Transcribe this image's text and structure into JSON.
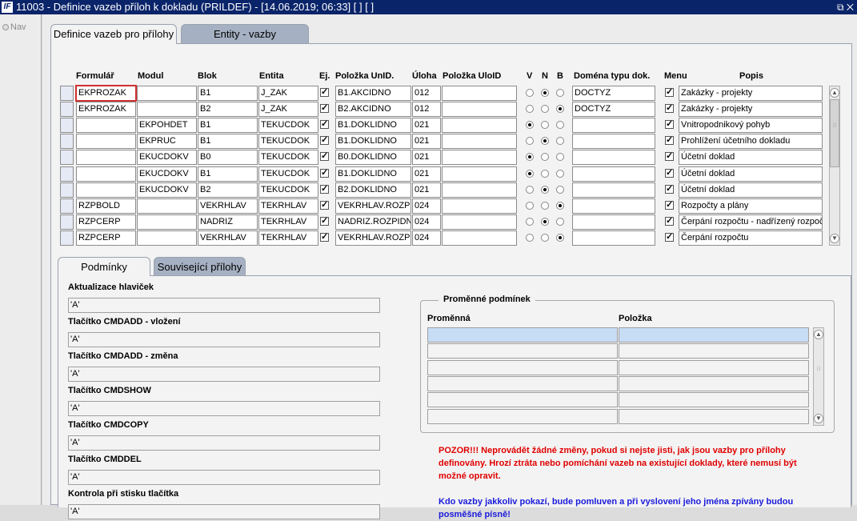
{
  "window": {
    "title": "11003 - Definice vazeb příloh k dokladu (PRILDEF) - [14.06.2019; 06:33]  [ ]  [ ]",
    "icon_text": "IF"
  },
  "nav": {
    "label": "Nav"
  },
  "tabs": [
    {
      "label": "Definice vazeb pro přílohy"
    },
    {
      "label": "Entity - vazby"
    }
  ],
  "grid": {
    "headers": {
      "formular": "Formulář",
      "modul": "Modul",
      "blok": "Blok",
      "entita": "Entita",
      "ej": "Ej.",
      "polozka_unid": "Položka UnID.",
      "uloha": "Úloha",
      "polozka_uloid": "Položka UloID",
      "v": "V",
      "n": "N",
      "b": "B",
      "domena": "Doména typu dok.",
      "menu": "Menu",
      "popis": "Popis"
    },
    "rows": [
      {
        "formular": "EKPROZAK",
        "modul": "",
        "blok": "B1",
        "entita": "J_ZAK",
        "ej": true,
        "polozka_unid": "B1.AKCIDNO",
        "uloha": "012",
        "polozka_uloid": "",
        "vnb": "N",
        "domena": "DOCTYZ",
        "menu": true,
        "popis": "Zakázky - projekty"
      },
      {
        "formular": "EKPROZAK",
        "modul": "",
        "blok": "B2",
        "entita": "J_ZAK",
        "ej": true,
        "polozka_unid": "B2.AKCIDNO",
        "uloha": "012",
        "polozka_uloid": "",
        "vnb": "B",
        "domena": "DOCTYZ",
        "menu": true,
        "popis": "Zakázky - projekty"
      },
      {
        "formular": "",
        "modul": "EKPOHDET",
        "blok": "B1",
        "entita": "TEKUCDOK",
        "ej": true,
        "polozka_unid": "B1.DOKLIDNO",
        "uloha": "021",
        "polozka_uloid": "",
        "vnb": "V",
        "domena": "",
        "menu": true,
        "popis": "Vnitropodnikový pohyb"
      },
      {
        "formular": "",
        "modul": "EKPRUC",
        "blok": "B1",
        "entita": "TEKUCDOK",
        "ej": true,
        "polozka_unid": "B1.DOKLIDNO",
        "uloha": "021",
        "polozka_uloid": "",
        "vnb": "N",
        "domena": "",
        "menu": true,
        "popis": "Prohlížení účetního dokladu"
      },
      {
        "formular": "",
        "modul": "EKUCDOKV",
        "blok": "B0",
        "entita": "TEKUCDOK",
        "ej": true,
        "polozka_unid": "B0.DOKLIDNO",
        "uloha": "021",
        "polozka_uloid": "",
        "vnb": "V",
        "domena": "",
        "menu": true,
        "popis": "Účetní doklad"
      },
      {
        "formular": "",
        "modul": "EKUCDOKV",
        "blok": "B1",
        "entita": "TEKUCDOK",
        "ej": true,
        "polozka_unid": "B1.DOKLIDNO",
        "uloha": "021",
        "polozka_uloid": "",
        "vnb": "V",
        "domena": "",
        "menu": true,
        "popis": "Účetní doklad"
      },
      {
        "formular": "",
        "modul": "EKUCDOKV",
        "blok": "B2",
        "entita": "TEKUCDOK",
        "ej": true,
        "polozka_unid": "B2.DOKLIDNO",
        "uloha": "021",
        "polozka_uloid": "",
        "vnb": "N",
        "domena": "",
        "menu": true,
        "popis": "Účetní doklad"
      },
      {
        "formular": "RZPBOLD",
        "modul": "",
        "blok": "VEKRHLAV",
        "entita": "TEKRHLAV",
        "ej": true,
        "polozka_unid": "VEKRHLAV.ROZPI",
        "uloha": "024",
        "polozka_uloid": "",
        "vnb": "B",
        "domena": "",
        "menu": true,
        "popis": "Rozpočty a plány"
      },
      {
        "formular": "RZPCERP",
        "modul": "",
        "blok": "NADRIZ",
        "entita": "TEKRHLAV",
        "ej": true,
        "polozka_unid": "NADRIZ.ROZPIDNC",
        "uloha": "024",
        "polozka_uloid": "",
        "vnb": "N",
        "domena": "",
        "menu": true,
        "popis": "Čerpání rozpočtu - nadřízený rozpoč"
      },
      {
        "formular": "RZPCERP",
        "modul": "",
        "blok": "VEKRHLAV",
        "entita": "TEKRHLAV",
        "ej": true,
        "polozka_unid": "VEKRHLAV.ROZPI",
        "uloha": "024",
        "polozka_uloid": "",
        "vnb": "B",
        "domena": "",
        "menu": true,
        "popis": "Čerpání rozpočtu"
      }
    ]
  },
  "subtabs": [
    {
      "label": "Podmínky"
    },
    {
      "label": "Související přílohy"
    }
  ],
  "conditions": [
    {
      "label": "Aktualizace hlaviček",
      "value": "'A'"
    },
    {
      "label": "Tlačítko CMDADD - vložení",
      "value": "'A'"
    },
    {
      "label": "Tlačítko CMDADD - změna",
      "value": "'A'"
    },
    {
      "label": "Tlačítko CMDSHOW",
      "value": "'A'"
    },
    {
      "label": "Tlačítko CMDCOPY",
      "value": "'A'"
    },
    {
      "label": "Tlačítko CMDDEL",
      "value": "'A'"
    },
    {
      "label": "Kontrola při stisku tlačítka",
      "value": "'A'"
    }
  ],
  "variables": {
    "title": "Proměnné podmínek",
    "col_var": "Proměnná",
    "col_item": "Položka"
  },
  "messages": {
    "warning": "POZOR!!! Neprovádět žádné změny, pokud si nejste jisti, jak jsou vazby pro přílohy definovány. Hrozí ztráta nebo pomíchání vazeb na existující doklady, které nemusí být možné opravit.",
    "notice": "Kdo vazby jakkoliv pokazí, bude pomluven a při vyslovení jeho jména zpívány budou posměšné písně!",
    "warning_color": "#e00000",
    "notice_color": "#1a1adc"
  }
}
